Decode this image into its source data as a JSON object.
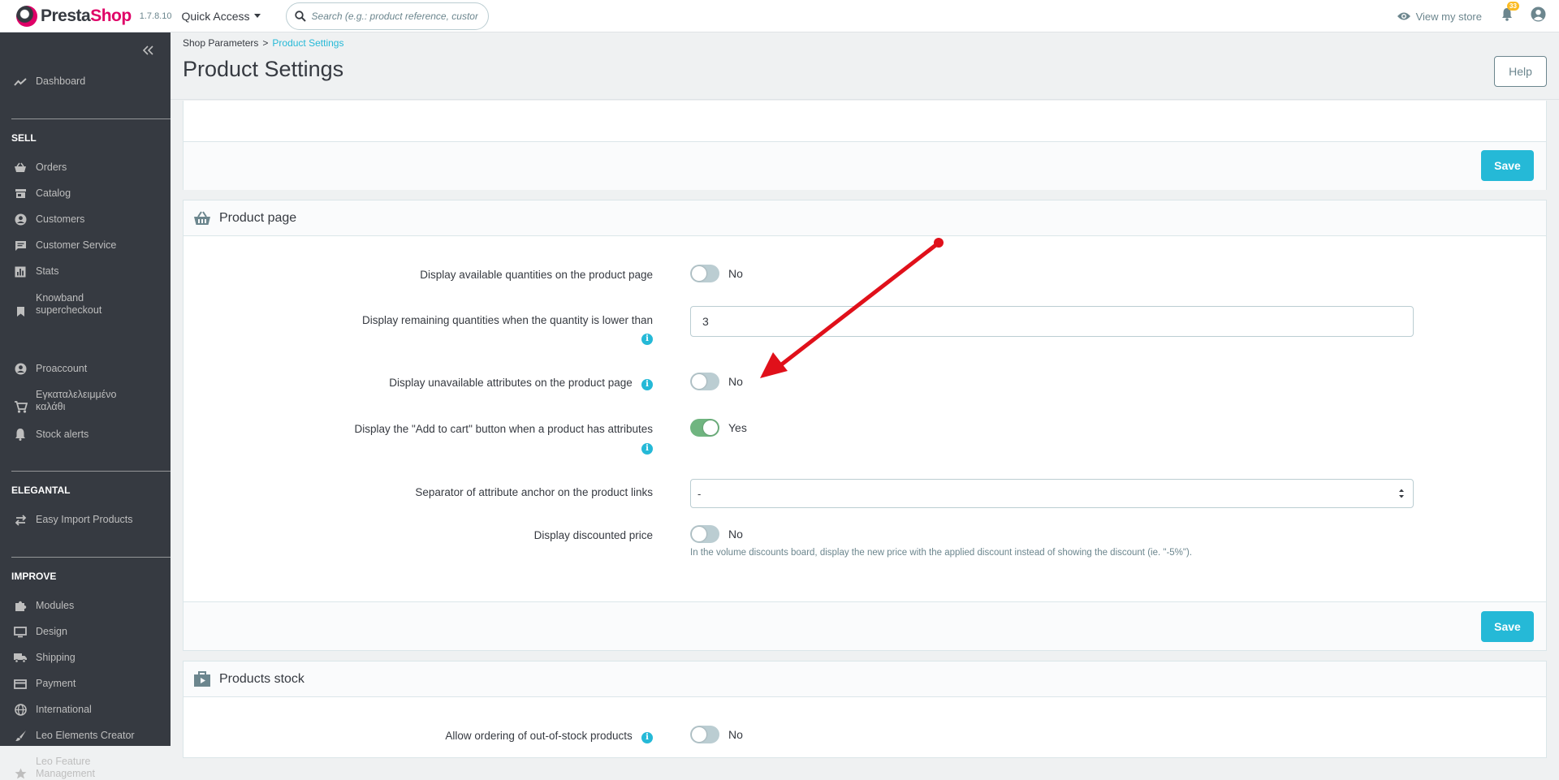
{
  "header": {
    "brand_a": "Presta",
    "brand_b": "Shop",
    "version": "1.7.8.10",
    "quick_access": "Quick Access",
    "search_placeholder": "Search (e.g.: product reference, custon",
    "view_store": "View my store",
    "notifications_count": "33"
  },
  "sidebar": {
    "collapse_icon": "double-chevron-left-icon",
    "dashboard": "Dashboard",
    "sections": {
      "sell": "SELL",
      "elegantal": "ELEGANTAL",
      "improve": "IMPROVE"
    },
    "items": {
      "orders": "Orders",
      "catalog": "Catalog",
      "customers": "Customers",
      "customer_service": "Customer Service",
      "stats": "Stats",
      "knowband_1": "Knowband",
      "knowband_2": "supercheckout",
      "proaccount": "Proaccount",
      "abandoned_1": "Εγκαταλελειμμένο",
      "abandoned_2": "καλάθι",
      "stock_alerts": "Stock alerts",
      "easy_import": "Easy Import Products",
      "modules": "Modules",
      "design": "Design",
      "shipping": "Shipping",
      "payment": "Payment",
      "international": "International",
      "leo_elements": "Leo Elements Creator",
      "leo_feature_1": "Leo Feature",
      "leo_feature_2": "Management"
    }
  },
  "page": {
    "breadcrumb_parent": "Shop Parameters",
    "breadcrumb_sep": ">",
    "breadcrumb_current": "Product Settings",
    "title": "Product Settings",
    "help": "Help",
    "save": "Save"
  },
  "product_page": {
    "title": "Product page",
    "rows": {
      "available_qty_label": "Display available quantities on the product page",
      "available_qty_value": "No",
      "remaining_qty_label": "Display remaining quantities when the quantity is lower than",
      "remaining_qty_value": "3",
      "unavailable_attr_label": "Display unavailable attributes on the product page",
      "unavailable_attr_value": "No",
      "add_to_cart_label": "Display the \"Add to cart\" button when a product has attributes",
      "add_to_cart_value": "Yes",
      "separator_label": "Separator of attribute anchor on the product links",
      "separator_value": "-",
      "discounted_label": "Display discounted price",
      "discounted_value": "No",
      "discounted_help": "In the volume discounts board, display the new price with the applied discount instead of showing the discount (ie. \"-5%\")."
    }
  },
  "products_stock": {
    "title": "Products stock",
    "allow_ordering_label": "Allow ordering of out-of-stock products",
    "allow_ordering_value": "No"
  },
  "colors": {
    "accent": "#25b9d7",
    "toggle_on": "#70b580",
    "brand_pink": "#df0067",
    "annotation_arrow": "#e0101a"
  }
}
